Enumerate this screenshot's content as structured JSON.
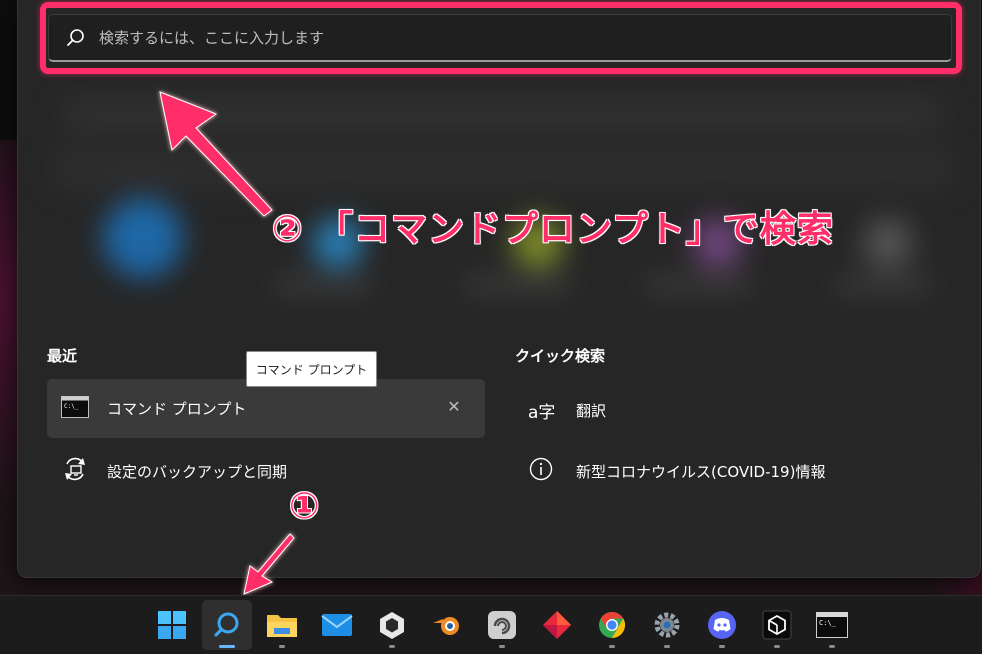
{
  "search": {
    "placeholder": "検索するには、ここに入力します"
  },
  "annotations": {
    "step2": "② 「コマンドプロンプト」で検索",
    "step1": "①",
    "highlight_color": "#ff2e68"
  },
  "recent": {
    "title": "最近",
    "items": [
      {
        "label": "コマンド プロンプト",
        "icon": "cmd-icon"
      },
      {
        "label": "設定のバックアップと同期",
        "icon": "backup-sync-icon"
      }
    ]
  },
  "tooltip": {
    "text": "コマンド プロンプト"
  },
  "quick_search": {
    "title": "クイック検索",
    "items": [
      {
        "label": "翻訳",
        "icon": "translate-icon"
      },
      {
        "label": "新型コロナウイルス(COVID-19)情報",
        "icon": "info-icon"
      }
    ]
  },
  "taskbar": {
    "icons": [
      {
        "name": "windows-start-icon",
        "running": false
      },
      {
        "name": "search-taskbar-icon",
        "running": false,
        "active": true
      },
      {
        "name": "file-explorer-icon",
        "running": true
      },
      {
        "name": "mail-icon",
        "running": false
      },
      {
        "name": "unity-hub-icon",
        "running": true
      },
      {
        "name": "blender-icon",
        "running": false
      },
      {
        "name": "app-swirl-icon",
        "running": true
      },
      {
        "name": "git-diamond-icon",
        "running": false
      },
      {
        "name": "chrome-icon",
        "running": true
      },
      {
        "name": "settings-gear-icon",
        "running": true
      },
      {
        "name": "discord-icon",
        "running": true
      },
      {
        "name": "unity-editor-icon",
        "running": true
      },
      {
        "name": "terminal-icon",
        "running": true
      }
    ]
  }
}
